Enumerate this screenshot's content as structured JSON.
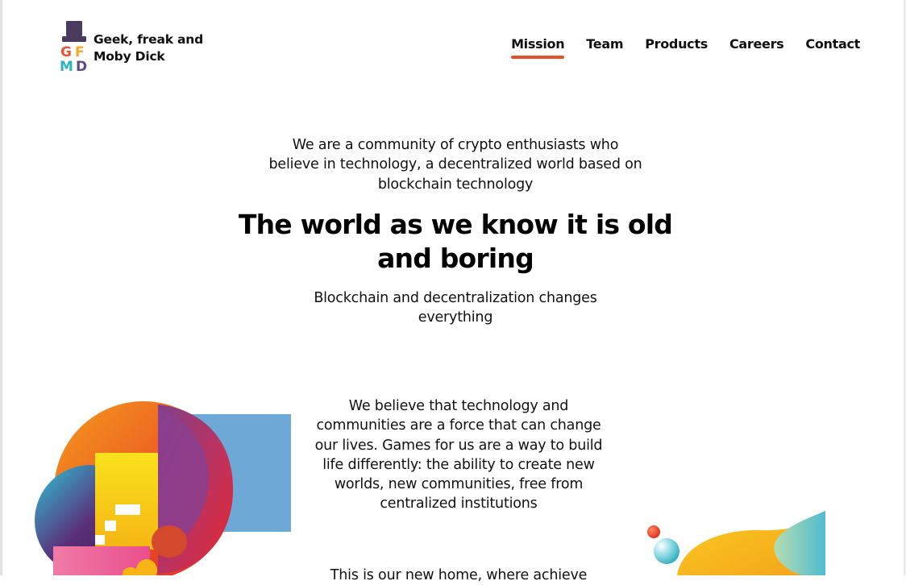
{
  "brand": {
    "logo_letters": [
      "G",
      "F",
      "M",
      "D"
    ],
    "name_line1": "Geek, freak and",
    "name_line2": "Moby Dick"
  },
  "nav": {
    "items": [
      {
        "label": "Mission",
        "active": true
      },
      {
        "label": "Team",
        "active": false
      },
      {
        "label": "Products",
        "active": false
      },
      {
        "label": "Careers",
        "active": false
      },
      {
        "label": "Contact",
        "active": false
      }
    ]
  },
  "hero": {
    "intro": "We are a community of crypto enthusiasts who believe in technology, a decentralized world based on blockchain technology",
    "headline": "The world as we know it is old and boring",
    "subline": "Blockchain and decentralization changes everything"
  },
  "section": {
    "belief": "We believe that technology and communities are a force that can change our lives. Games for us are a way to build life differently: the ability to create new worlds, new communities, free from centralized institutions",
    "next_paragraph_partial": "This is our new home, where achieve"
  },
  "colors": {
    "accent": "#e4522f",
    "hat": "#4a3b5e",
    "letter_g": "#e8533a",
    "letter_f": "#f5a623",
    "letter_m": "#2bb3c0",
    "letter_d": "#5b4b86",
    "blue_square": "#6ea8d6"
  },
  "icons": {
    "logo": "top-hat-icon"
  }
}
